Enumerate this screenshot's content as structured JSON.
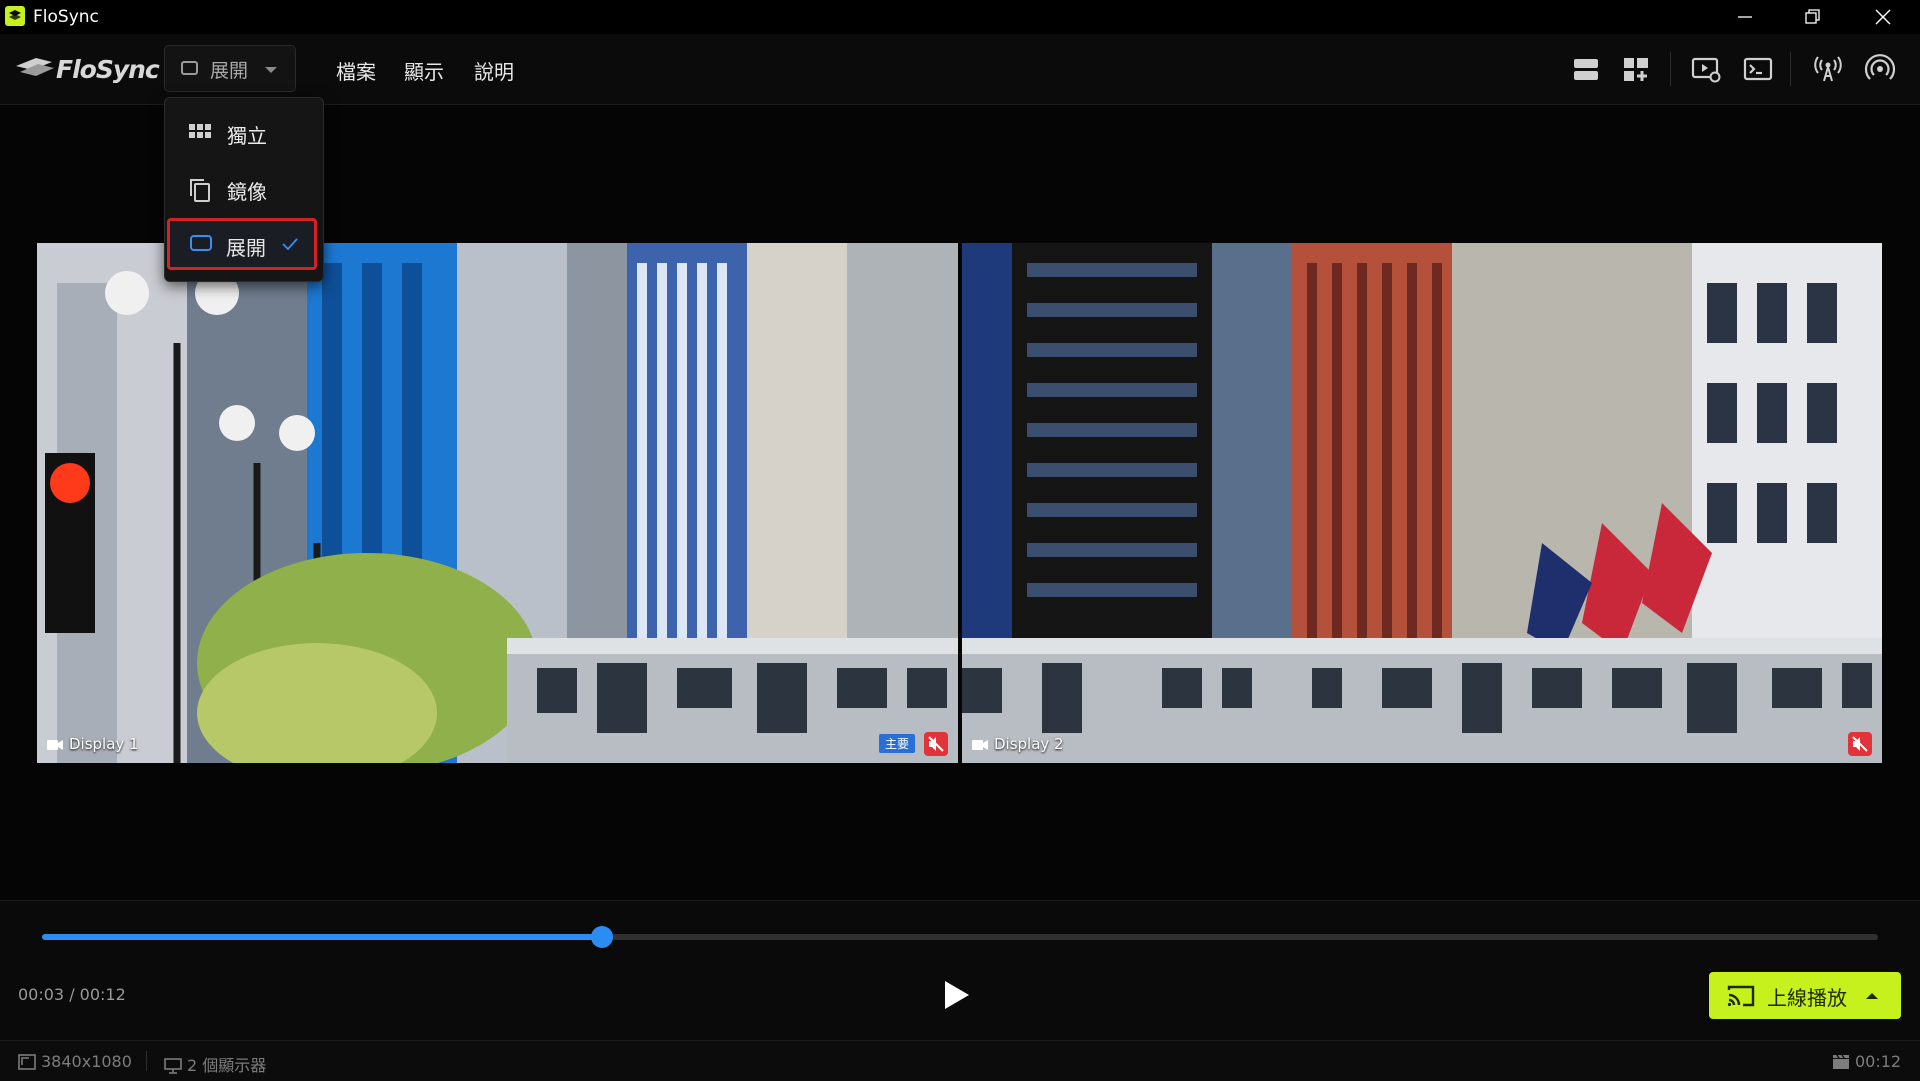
{
  "window": {
    "title": "FloSync"
  },
  "header": {
    "logo_text": "FloSync",
    "mode_button_label": "展開",
    "menus": [
      "檔案",
      "顯示",
      "說明"
    ]
  },
  "dropdown": {
    "items": [
      {
        "label": "獨立",
        "icon": "grid-icon"
      },
      {
        "label": "鏡像",
        "icon": "copy-icon"
      },
      {
        "label": "展開",
        "icon": "extend-icon",
        "selected": true
      }
    ]
  },
  "displays": [
    {
      "label": "Display 1",
      "badge": "主要",
      "muted": true
    },
    {
      "label": "Display 2",
      "muted": true
    }
  ],
  "player": {
    "progress": 0.305,
    "time_display": "00:03 / 00:12",
    "cast_label": "上線播放"
  },
  "status": {
    "resolution": "3840x1080",
    "displays_count": "2 個顯示器",
    "duration": "00:12"
  },
  "colors": {
    "accent": "#2c8cf4",
    "cast": "#c7f11c",
    "highlight": "#d32424"
  }
}
